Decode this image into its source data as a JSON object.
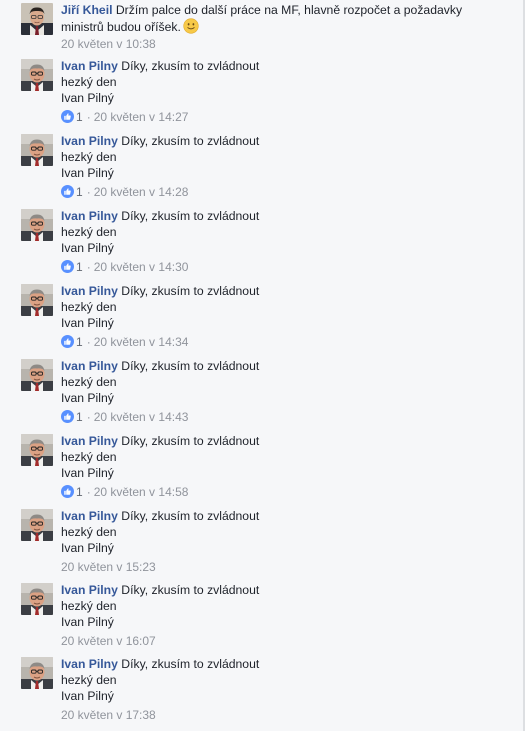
{
  "comments": [
    {
      "author": "Jiří Kheil",
      "lines": [
        "Držím palce do další práce na MF, hlavně rozpočet a požadavky",
        "ministrů budou oříšek."
      ],
      "emoji": "slightly-smiling-face-emoji",
      "timestamp": "20 květen v 10:38",
      "avatar": "avatar-jiri-kheil",
      "likes": null
    },
    {
      "author": "Ivan Pilny",
      "lines": [
        "Díky, zkusím to zvládnout",
        "hezký den",
        "Ivan Pilný"
      ],
      "timestamp": "20 květen v 14:27",
      "avatar": "avatar-ivan-pilny",
      "likes": "1"
    },
    {
      "author": "Ivan Pilny",
      "lines": [
        "Díky, zkusím to zvládnout",
        "hezký den",
        "Ivan Pilný"
      ],
      "timestamp": "20 květen v 14:28",
      "avatar": "avatar-ivan-pilny",
      "likes": "1"
    },
    {
      "author": "Ivan Pilny",
      "lines": [
        "Díky, zkusím to zvládnout",
        "hezký den",
        "Ivan Pilný"
      ],
      "timestamp": "20 květen v 14:30",
      "avatar": "avatar-ivan-pilny",
      "likes": "1"
    },
    {
      "author": "Ivan Pilny",
      "lines": [
        "Díky, zkusím to zvládnout",
        "hezký den",
        "Ivan Pilný"
      ],
      "timestamp": "20 květen v 14:34",
      "avatar": "avatar-ivan-pilny",
      "likes": "1"
    },
    {
      "author": "Ivan Pilny",
      "lines": [
        "Díky, zkusím to zvládnout",
        "hezký den",
        "Ivan Pilný"
      ],
      "timestamp": "20 květen v 14:43",
      "avatar": "avatar-ivan-pilny",
      "likes": "1"
    },
    {
      "author": "Ivan Pilny",
      "lines": [
        "Díky, zkusím to zvládnout",
        "hezký den",
        "Ivan Pilný"
      ],
      "timestamp": "20 květen v 14:58",
      "avatar": "avatar-ivan-pilny",
      "likes": "1"
    },
    {
      "author": "Ivan Pilny",
      "lines": [
        "Díky, zkusím to zvládnout",
        "hezký den",
        "Ivan Pilný"
      ],
      "timestamp": "20 květen v 15:23",
      "avatar": "avatar-ivan-pilny",
      "likes": null
    },
    {
      "author": "Ivan Pilny",
      "lines": [
        "Díky, zkusím to zvládnout",
        "hezký den",
        "Ivan Pilný"
      ],
      "timestamp": "20 květen v 16:07",
      "avatar": "avatar-ivan-pilny",
      "likes": null
    },
    {
      "author": "Ivan Pilny",
      "lines": [
        "Díky, zkusím to zvládnout",
        "hezký den",
        "Ivan Pilný"
      ],
      "timestamp": "20 květen v 17:38",
      "avatar": "avatar-ivan-pilny",
      "likes": null
    }
  ],
  "meta_separator": "·",
  "colors": {
    "author_link": "#365899",
    "text": "#1d2129",
    "meta": "#90949c",
    "like_blue": "#5890ff",
    "background": "#f6f7f9"
  },
  "icons": {
    "like": "like-thumb-icon",
    "emoji": "slightly-smiling-face-emoji"
  }
}
